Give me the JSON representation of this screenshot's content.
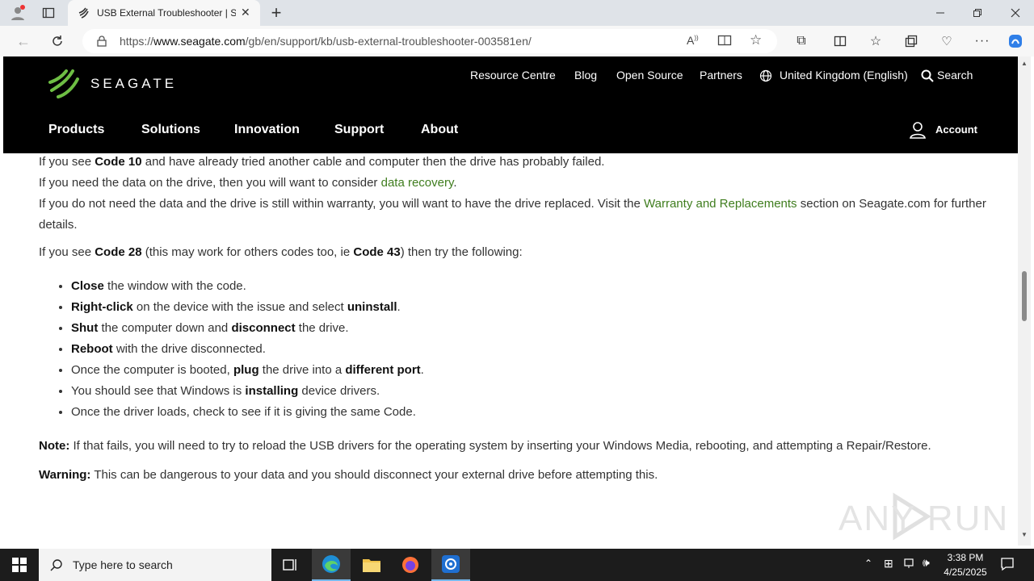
{
  "browser": {
    "tab_title": "USB External Troubleshooter | Sea",
    "url_prefix": "https://",
    "url_domain": "www.seagate.com",
    "url_path": "/gb/en/support/kb/usb-external-troubleshooter-003581en/"
  },
  "site": {
    "logo_text": "SEAGATE",
    "top_links": [
      "Resource Centre",
      "Blog",
      "Open Source",
      "Partners",
      "United Kingdom (English)",
      "Search"
    ],
    "main_nav": [
      "Products",
      "Solutions",
      "Innovation",
      "Support",
      "About"
    ],
    "account_label": "Account"
  },
  "content": {
    "p1_a": "If you see ",
    "p1_b": "Code 10",
    "p1_c": " and have already tried another cable and computer then the drive has probably failed.",
    "p2_a": "If you need the data on the drive, then you will want to consider ",
    "p2_link": "data recovery",
    "p2_c": ".",
    "p3_a": "If you do not need the data and the drive is still within warranty, you will want to have the drive replaced. Visit the ",
    "p3_link": "Warranty and Replacements",
    "p3_c": " section on Seagate.com for further details.",
    "p4_a": "If you see ",
    "p4_b": "Code 28",
    "p4_c": " (this may work for others codes too, ie ",
    "p4_d": "Code 43",
    "p4_e": ") then try the following:",
    "steps": [
      {
        "b": "Close",
        "t": " the window with the code."
      },
      {
        "b": "Right-click",
        "t": " on the device with the issue and select ",
        "b2": "uninstall",
        "t2": "."
      },
      {
        "b": "Shut",
        "t": " the computer down and ",
        "b2": "disconnect",
        "t2": " the drive."
      },
      {
        "b": "Reboot",
        "t": " with the drive disconnected."
      },
      {
        "pre": "Once the computer is booted, ",
        "b": "plug",
        "t": " the drive into a ",
        "b2": "different port",
        "t2": "."
      },
      {
        "pre": "You should see that Windows is ",
        "b": "installing",
        "t": " device drivers."
      },
      {
        "pre": "Once the driver loads, check to see if it is giving the same Code."
      }
    ],
    "note_label": "Note:",
    "note_text": " If that fails, you will need to try to reload the USB drivers for the operating system by inserting your Windows Media, rebooting, and attempting a Repair/Restore.",
    "warning_label": "Warning:",
    "warning_text": " This can be dangerous to your data and you should disconnect your external drive before attempting this."
  },
  "watermark": "ANY RUN",
  "taskbar": {
    "search_placeholder": "Type here to search",
    "time": "3:38 PM",
    "date": "4/25/2025"
  },
  "colors": {
    "link_green": "#3f7d1e",
    "brand_green": "#6ebe44",
    "header_bg": "#000000"
  }
}
